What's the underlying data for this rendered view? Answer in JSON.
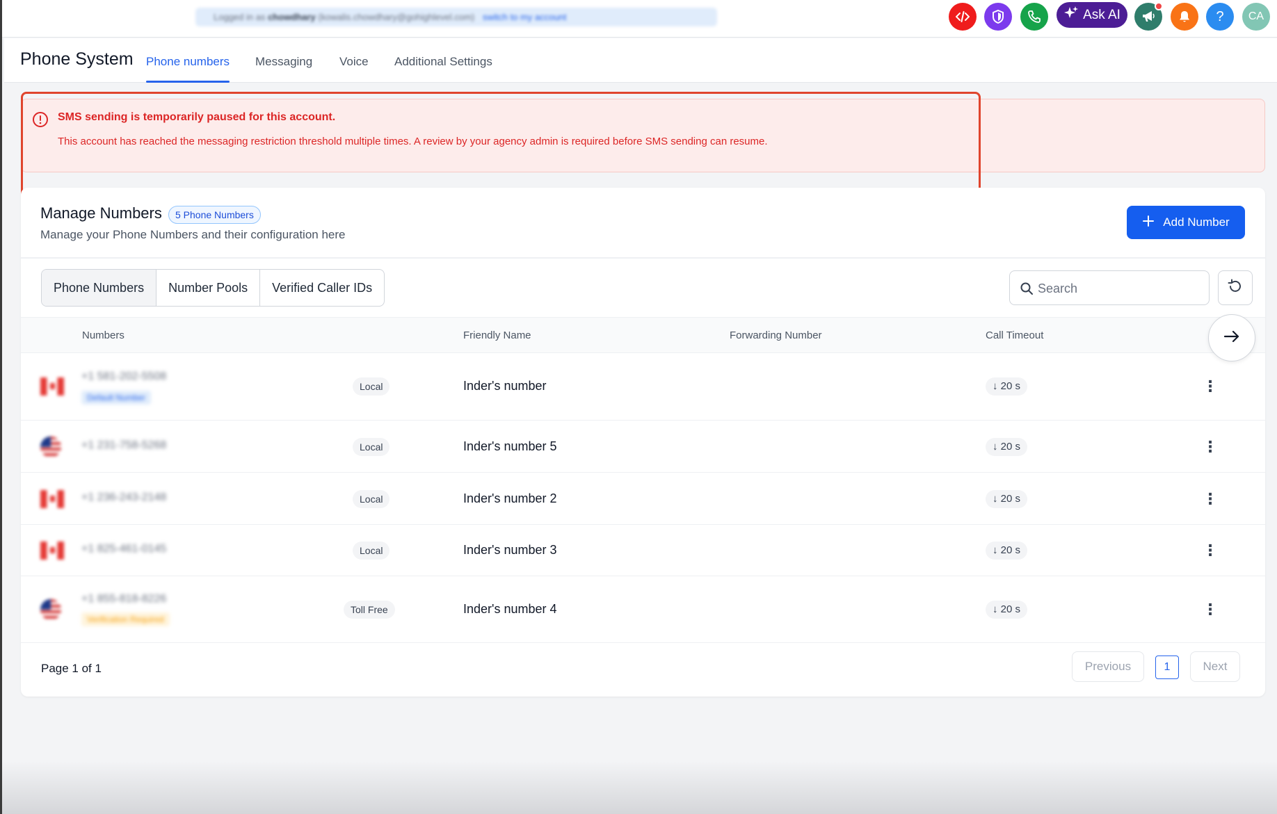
{
  "topbar": {
    "login_banner": {
      "prefix": "Logged in as",
      "user": "chowdhary",
      "email": "(kowalis.chowdhary@gohighlevel.com)",
      "switch_label": "switch to my account"
    },
    "icons": [
      {
        "name": "code-icon",
        "color": "#ef1c1c"
      },
      {
        "name": "shield-icon",
        "color": "#7c3aed"
      },
      {
        "name": "phone-icon",
        "color": "#16a34a"
      },
      {
        "name": "megaphone-icon",
        "color": "#2f7d6b"
      },
      {
        "name": "bell-icon",
        "color": "#f97316"
      },
      {
        "name": "help-icon",
        "color": "#2b8cf0"
      }
    ],
    "ask_ai_label": "Ask AI",
    "help_label": "?",
    "avatar_initials": "CA"
  },
  "header": {
    "title": "Phone System",
    "tabs": [
      {
        "label": "Phone numbers",
        "active": true
      },
      {
        "label": "Messaging",
        "active": false
      },
      {
        "label": "Voice",
        "active": false
      },
      {
        "label": "Additional Settings",
        "active": false
      }
    ]
  },
  "alert": {
    "title": "SMS sending is temporarily paused for this account.",
    "message": "This account has reached the messaging restriction threshold multiple times. A review by your agency admin is required before SMS sending can resume."
  },
  "manage": {
    "title": "Manage Numbers",
    "badge": "5 Phone Numbers",
    "subtitle": "Manage your Phone Numbers and their configuration here",
    "add_button": "Add Number",
    "segments": [
      {
        "label": "Phone Numbers",
        "active": true
      },
      {
        "label": "Number Pools",
        "active": false
      },
      {
        "label": "Verified Caller IDs",
        "active": false
      }
    ],
    "search_placeholder": "Search",
    "columns": {
      "numbers": "Numbers",
      "friendly_name": "Friendly Name",
      "forwarding_number": "Forwarding Number",
      "call_timeout": "Call Timeout"
    },
    "rows": [
      {
        "flag": "ca",
        "number": "+1 581-202-5508",
        "sub": "Default Number",
        "sub_style": "blue",
        "type": "Local",
        "friendly": "Inder's number",
        "timeout": "20 s"
      },
      {
        "flag": "us",
        "number": "+1 231-758-5268",
        "sub": "",
        "sub_style": "",
        "type": "Local",
        "friendly": "Inder's number 5",
        "timeout": "20 s"
      },
      {
        "flag": "ca",
        "number": "+1 236-243-2148",
        "sub": "",
        "sub_style": "",
        "type": "Local",
        "friendly": "Inder's number 2",
        "timeout": "20 s"
      },
      {
        "flag": "ca",
        "number": "+1 825-461-0145",
        "sub": "",
        "sub_style": "",
        "type": "Local",
        "friendly": "Inder's number 3",
        "timeout": "20 s"
      },
      {
        "flag": "us",
        "number": "+1 855-818-8226",
        "sub": "Verification Required",
        "sub_style": "amber",
        "type": "Toll Free",
        "friendly": "Inder's number 4",
        "timeout": "20 s"
      }
    ],
    "pagination": {
      "info": "Page 1 of 1",
      "previous": "Previous",
      "current": "1",
      "next": "Next"
    }
  },
  "colors": {
    "accent": "#2563eb",
    "alert_text": "#dc2626",
    "alert_bg": "#fdeceb",
    "highlight_border": "#e0452d"
  }
}
